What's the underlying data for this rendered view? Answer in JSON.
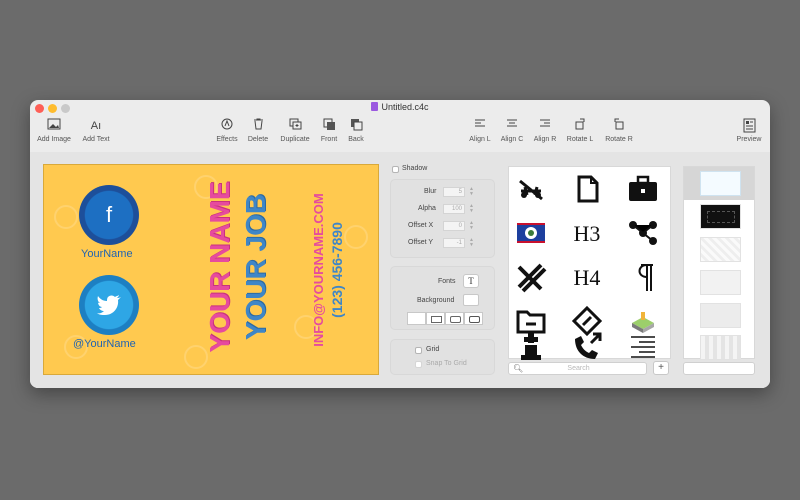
{
  "window": {
    "title": "Untitled.c4c"
  },
  "toolbar": {
    "add_image": "Add Image",
    "add_text": "Add Text",
    "effects": "Effects",
    "delete": "Delete",
    "duplicate": "Duplicate",
    "front": "Front",
    "back": "Back",
    "align_l": "Align L",
    "align_c": "Align C",
    "align_r": "Align R",
    "rotate_l": "Rotate L",
    "rotate_r": "Rotate R",
    "preview": "Preview"
  },
  "card": {
    "facebook_glyph": "f",
    "facebook_name": "YourName",
    "twitter_handle": "@YourName",
    "name_text": "YOUR NAME",
    "job_text": "YOUR JOB",
    "email_text": "INFO@YOURNAME.COM",
    "phone_text": "(123) 456-7890",
    "colors": {
      "background": "#ffc94f",
      "pink": "#e64b9e",
      "blue": "#3f86c7"
    }
  },
  "shadow_panel": {
    "shadow_label": "Shadow",
    "blur_label": "Blur",
    "blur_value": "5",
    "alpha_label": "Alpha",
    "alpha_value": "100",
    "offset_x_label": "Offset X",
    "offset_x_value": "0",
    "offset_y_label": "Offset Y",
    "offset_y_value": "-1"
  },
  "style_panel": {
    "fonts_label": "Fonts",
    "fonts_button": "T",
    "background_label": "Background"
  },
  "grid_panel": {
    "grid_label": "Grid",
    "snap_label": "Snap To Grid"
  },
  "icon_library": {
    "icons": [
      "no-fly-drone-icon",
      "file-icon",
      "briefcase-icon",
      "belize-flag-icon",
      "heading-3-icon",
      "network-nodes-icon",
      "pencil-ruler-icon",
      "heading-4-icon",
      "pilcrow-icon",
      "folder-minus-icon",
      "road-sign-icon",
      "map-icon",
      "chess-piece-icon",
      "phone-outgoing-icon",
      "align-right-lines-icon"
    ],
    "h3_text": "H3",
    "h4_text": "H4",
    "search_placeholder": "Search",
    "add_label": "+"
  }
}
